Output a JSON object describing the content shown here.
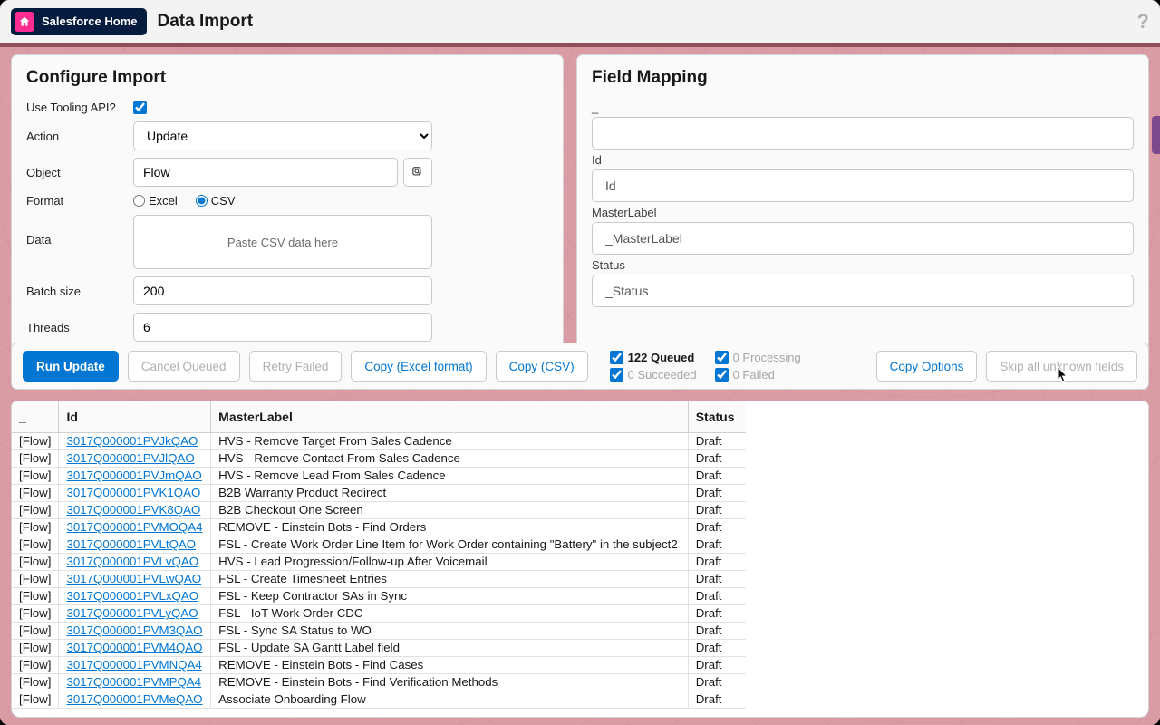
{
  "header": {
    "home_label": "Salesforce Home",
    "page_title": "Data Import"
  },
  "configure": {
    "title": "Configure Import",
    "tooling_label": "Use Tooling API?",
    "tooling_checked": true,
    "action_label": "Action",
    "action_value": "Update",
    "object_label": "Object",
    "object_value": "Flow",
    "format_label": "Format",
    "format_excel": "Excel",
    "format_csv": "CSV",
    "data_label": "Data",
    "data_placeholder": "Paste CSV data here",
    "batch_label": "Batch size",
    "batch_value": "200",
    "threads_label": "Threads",
    "threads_value": "6"
  },
  "mapping": {
    "title": "Field Mapping",
    "fields": [
      {
        "label": "_",
        "value": "_"
      },
      {
        "label": "Id",
        "value": "Id"
      },
      {
        "label": "MasterLabel",
        "value": "_MasterLabel"
      },
      {
        "label": "Status",
        "value": "_Status"
      }
    ]
  },
  "actions": {
    "run": "Run Update",
    "cancel": "Cancel Queued",
    "retry": "Retry Failed",
    "copy_excel": "Copy (Excel format)",
    "copy_csv": "Copy (CSV)",
    "copy_options": "Copy Options",
    "skip": "Skip all unknown fields"
  },
  "status": {
    "queued": "122 Queued",
    "processing": "0 Processing",
    "succeeded": "0 Succeeded",
    "failed": "0 Failed"
  },
  "table": {
    "headers": {
      "c0": "_",
      "c1": "Id",
      "c2": "MasterLabel",
      "c3": "Status"
    },
    "rows": [
      {
        "c0": "[Flow]",
        "c1": "3017Q000001PVJkQAO",
        "c2": "HVS - Remove Target From Sales Cadence",
        "c3": "Draft"
      },
      {
        "c0": "[Flow]",
        "c1": "3017Q000001PVJlQAO",
        "c2": "HVS - Remove Contact From Sales Cadence",
        "c3": "Draft"
      },
      {
        "c0": "[Flow]",
        "c1": "3017Q000001PVJmQAO",
        "c2": "HVS - Remove Lead From Sales Cadence",
        "c3": "Draft"
      },
      {
        "c0": "[Flow]",
        "c1": "3017Q000001PVK1QAO",
        "c2": "B2B Warranty Product Redirect",
        "c3": "Draft"
      },
      {
        "c0": "[Flow]",
        "c1": "3017Q000001PVK8QAO",
        "c2": "B2B Checkout One Screen",
        "c3": "Draft"
      },
      {
        "c0": "[Flow]",
        "c1": "3017Q000001PVMOQA4",
        "c2": "REMOVE - Einstein Bots - Find Orders",
        "c3": "Draft"
      },
      {
        "c0": "[Flow]",
        "c1": "3017Q000001PVLtQAO",
        "c2": "FSL - Create Work Order Line Item for Work Order containing \"Battery\" in the subject2",
        "c3": "Draft"
      },
      {
        "c0": "[Flow]",
        "c1": "3017Q000001PVLvQAO",
        "c2": "HVS - Lead Progression/Follow-up After Voicemail",
        "c3": "Draft"
      },
      {
        "c0": "[Flow]",
        "c1": "3017Q000001PVLwQAO",
        "c2": "FSL - Create Timesheet Entries",
        "c3": "Draft"
      },
      {
        "c0": "[Flow]",
        "c1": "3017Q000001PVLxQAO",
        "c2": "FSL - Keep Contractor SAs in Sync",
        "c3": "Draft"
      },
      {
        "c0": "[Flow]",
        "c1": "3017Q000001PVLyQAO",
        "c2": "FSL - IoT Work Order CDC",
        "c3": "Draft"
      },
      {
        "c0": "[Flow]",
        "c1": "3017Q000001PVM3QAO",
        "c2": "FSL - Sync SA Status to WO",
        "c3": "Draft"
      },
      {
        "c0": "[Flow]",
        "c1": "3017Q000001PVM4QAO",
        "c2": "FSL - Update SA Gantt Label field",
        "c3": "Draft"
      },
      {
        "c0": "[Flow]",
        "c1": "3017Q000001PVMNQA4",
        "c2": "REMOVE - Einstein Bots - Find Cases",
        "c3": "Draft"
      },
      {
        "c0": "[Flow]",
        "c1": "3017Q000001PVMPQA4",
        "c2": "REMOVE - Einstein Bots - Find Verification Methods",
        "c3": "Draft"
      },
      {
        "c0": "[Flow]",
        "c1": "3017Q000001PVMeQAO",
        "c2": "Associate Onboarding Flow",
        "c3": "Draft"
      }
    ]
  }
}
